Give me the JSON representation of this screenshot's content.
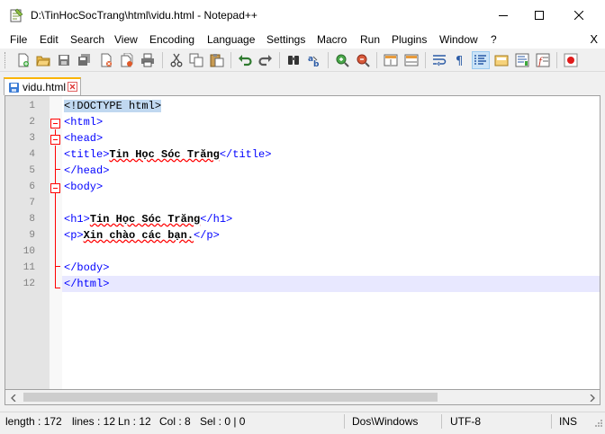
{
  "window": {
    "title": "D:\\TinHocSocTrang\\html\\vidu.html - Notepad++"
  },
  "menu": {
    "items": [
      "File",
      "Edit",
      "Search",
      "View",
      "Encoding",
      "Language",
      "Settings",
      "Macro",
      "Run",
      "Plugins",
      "Window",
      "?"
    ],
    "close": "X"
  },
  "toolbar": {
    "buttons": [
      "new-file",
      "open-file",
      "save",
      "save-all",
      "close",
      "close-all",
      "print",
      "cut",
      "copy",
      "paste",
      "undo",
      "redo",
      "find",
      "replace",
      "zoom-in",
      "zoom-out",
      "sync-vertical",
      "sync-horizontal",
      "word-wrap",
      "show-all-characters",
      "indent-guide",
      "user-defined-language",
      "document-map",
      "function-list",
      "record-macro"
    ]
  },
  "tabs": [
    {
      "label": "vidu.html"
    }
  ],
  "editor": {
    "lines": [
      {
        "n": "1",
        "text": "<!DOCTYPE html>"
      },
      {
        "n": "2",
        "text": "<html>"
      },
      {
        "n": "3",
        "text": "<head>"
      },
      {
        "n": "4",
        "text": "<title>Tin Học Sóc Trăng</title>"
      },
      {
        "n": "5",
        "text": "</head>"
      },
      {
        "n": "6",
        "text": "<body>"
      },
      {
        "n": "7",
        "text": ""
      },
      {
        "n": "8",
        "text": "<h1>Tin Học Sóc Trăng</h1>"
      },
      {
        "n": "9",
        "text": "<p>Xin chào các bạn.</p>"
      },
      {
        "n": "10",
        "text": ""
      },
      {
        "n": "11",
        "text": "</body>"
      },
      {
        "n": "12",
        "text": "</html>"
      }
    ],
    "current_line": 12
  },
  "status": {
    "length": "length : 172",
    "lines": "lines : 12",
    "ln": "Ln : 12",
    "col": "Col : 8",
    "sel": "Sel : 0 | 0",
    "eol": "Dos\\Windows",
    "encoding": "UTF-8",
    "mode": "INS"
  },
  "colors": {
    "tag": "#0000ff",
    "fold_marker": "#ff0000",
    "current_line": "#e8e8ff",
    "active_tab_accent": "#fab400"
  }
}
